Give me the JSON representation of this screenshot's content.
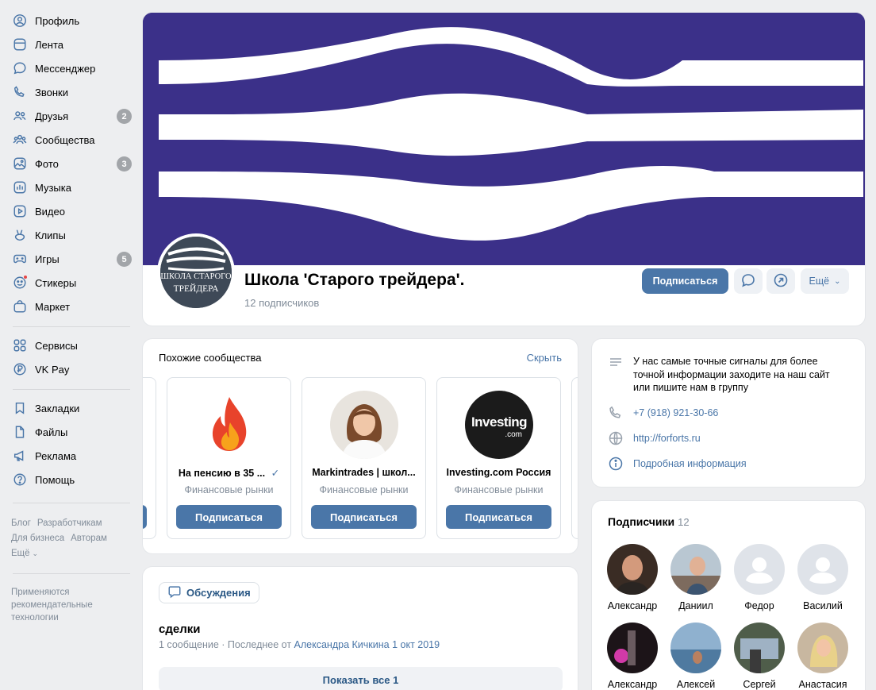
{
  "nav": {
    "items": [
      {
        "label": "Профиль",
        "icon": "user-circle-icon"
      },
      {
        "label": "Лента",
        "icon": "feed-icon"
      },
      {
        "label": "Мессенджер",
        "icon": "message-icon"
      },
      {
        "label": "Звонки",
        "icon": "phone-icon"
      },
      {
        "label": "Друзья",
        "icon": "friends-icon",
        "count": "2"
      },
      {
        "label": "Сообщества",
        "icon": "communities-icon"
      },
      {
        "label": "Фото",
        "icon": "photo-icon",
        "count": "3"
      },
      {
        "label": "Музыка",
        "icon": "music-icon"
      },
      {
        "label": "Видео",
        "icon": "video-icon"
      },
      {
        "label": "Клипы",
        "icon": "clips-icon"
      },
      {
        "label": "Игры",
        "icon": "games-icon",
        "count": "5"
      },
      {
        "label": "Стикеры",
        "icon": "stickers-icon"
      },
      {
        "label": "Маркет",
        "icon": "market-icon"
      },
      {
        "label": "Сервисы",
        "icon": "services-icon"
      },
      {
        "label": "VK Pay",
        "icon": "vkpay-icon"
      },
      {
        "label": "Закладки",
        "icon": "bookmark-icon"
      },
      {
        "label": "Файлы",
        "icon": "file-icon"
      },
      {
        "label": "Реклама",
        "icon": "megaphone-icon"
      },
      {
        "label": "Помощь",
        "icon": "help-icon"
      }
    ],
    "footer_links": [
      "Блог",
      "Разработчикам",
      "Для бизнеса",
      "Авторам",
      "Ещё"
    ],
    "reco_text": "Применяются рекомендательные технологии"
  },
  "group": {
    "name": "Школа 'Старого трейдера'.",
    "subscribers": "12 подписчиков",
    "avatar_text_1": "ШКОЛА СТАРОГО",
    "avatar_text_2": "ТРЕЙДЕРА",
    "subscribe_label": "Подписаться",
    "more_label": "Ещё",
    "cover_color": "#3b3089"
  },
  "similar": {
    "title": "Похожие сообщества",
    "hide_label": "Скрыть",
    "items": [
      {
        "name": "На пенсию в 35 ...",
        "category": "Финансовые рынки",
        "button": "Подписаться",
        "verified": true
      },
      {
        "name": "Markintrades | школ...",
        "category": "Финансовые рынки",
        "button": "Подписаться"
      },
      {
        "name": "Investing.com Россия",
        "category": "Финансовые рынки",
        "button": "Подписаться",
        "logo_text": "Investing",
        "logo_sub": ".com"
      }
    ]
  },
  "info": {
    "description": "У нас самые точные сигналы для более точной информации заходите на наш сайт или пишите нам в группу",
    "phone": "+7 (918) 921-30-66",
    "site": "http://forforts.ru",
    "details": "Подробная информация"
  },
  "subscribers": {
    "title": "Подписчики",
    "count": "12",
    "people": [
      {
        "name": "Александр"
      },
      {
        "name": "Даниил"
      },
      {
        "name": "Федор"
      },
      {
        "name": "Василий"
      },
      {
        "name": "Александр"
      },
      {
        "name": "Алексей"
      },
      {
        "name": "Сергей"
      },
      {
        "name": "Анастасия"
      }
    ]
  },
  "discussions": {
    "tab_label": "Обсуждения",
    "topic": "сделки",
    "meta_prefix": "1 сообщение · Последнее от ",
    "meta_author": "Александра Кичкина",
    "meta_date": "1 окт 2019",
    "show_all": "Показать все 1"
  }
}
